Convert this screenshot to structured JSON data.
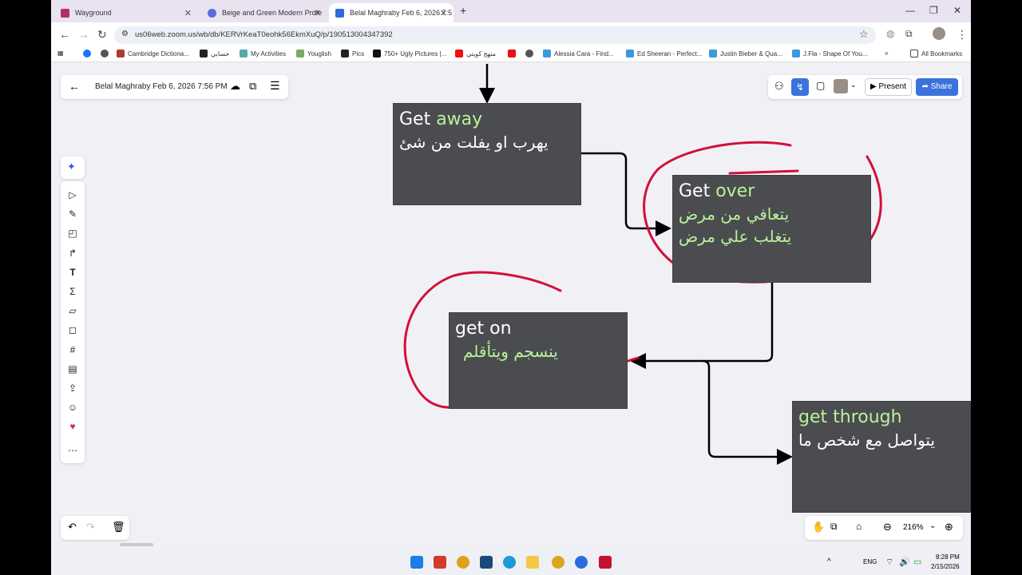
{
  "browser": {
    "tabs": [
      {
        "label": "Wayground",
        "color": "#b0306e"
      },
      {
        "label": "Beige and Green Modern Profe",
        "color": "#5a6bd8"
      },
      {
        "label": "Belal Maghraby Feb 6, 2026 7:5",
        "color": "#2d6ce0",
        "active": true
      }
    ],
    "new_tab": "+",
    "url": "us06web.zoom.us/wb/db/KERVrKeaT0eohk56EkmXuQ/p/190513004347392",
    "bookmarks": [
      "Cambridge Dictiona...",
      "حسابي",
      "My Activities",
      "Youglish",
      "Pics",
      "750+ Ugly Pictures |...",
      "منهج كويتي",
      "Alessia Cara - Find...",
      "Ed Sheeran - Perfect...",
      "Justin Bieber & Qua...",
      "J.Fla - Shape Of You..."
    ],
    "all_bookmarks": "All Bookmarks"
  },
  "app": {
    "doc_title": "Belal Maghraby Feb 6, 2026 7:56 PM",
    "present_label": "Present",
    "share_label": "Share",
    "zoom_level": "216%",
    "accent": "#3b73dd"
  },
  "cards": {
    "away": {
      "prefix": "Get ",
      "word": "away",
      "arabic": "يهرب او يفلت من شئ"
    },
    "over": {
      "prefix": "Get ",
      "word": "over",
      "arabic1": "يتعافي من مرض",
      "arabic2": "يتغلب علي مرض"
    },
    "on": {
      "title": "get on",
      "arabic": "ينسجم ويتأقلم"
    },
    "through": {
      "title": "get through",
      "arabic": "يتواصل مع شخص ما"
    }
  },
  "taskbar": {
    "lang": "ENG",
    "time": "8:28 PM",
    "date": "2/15/2026"
  }
}
